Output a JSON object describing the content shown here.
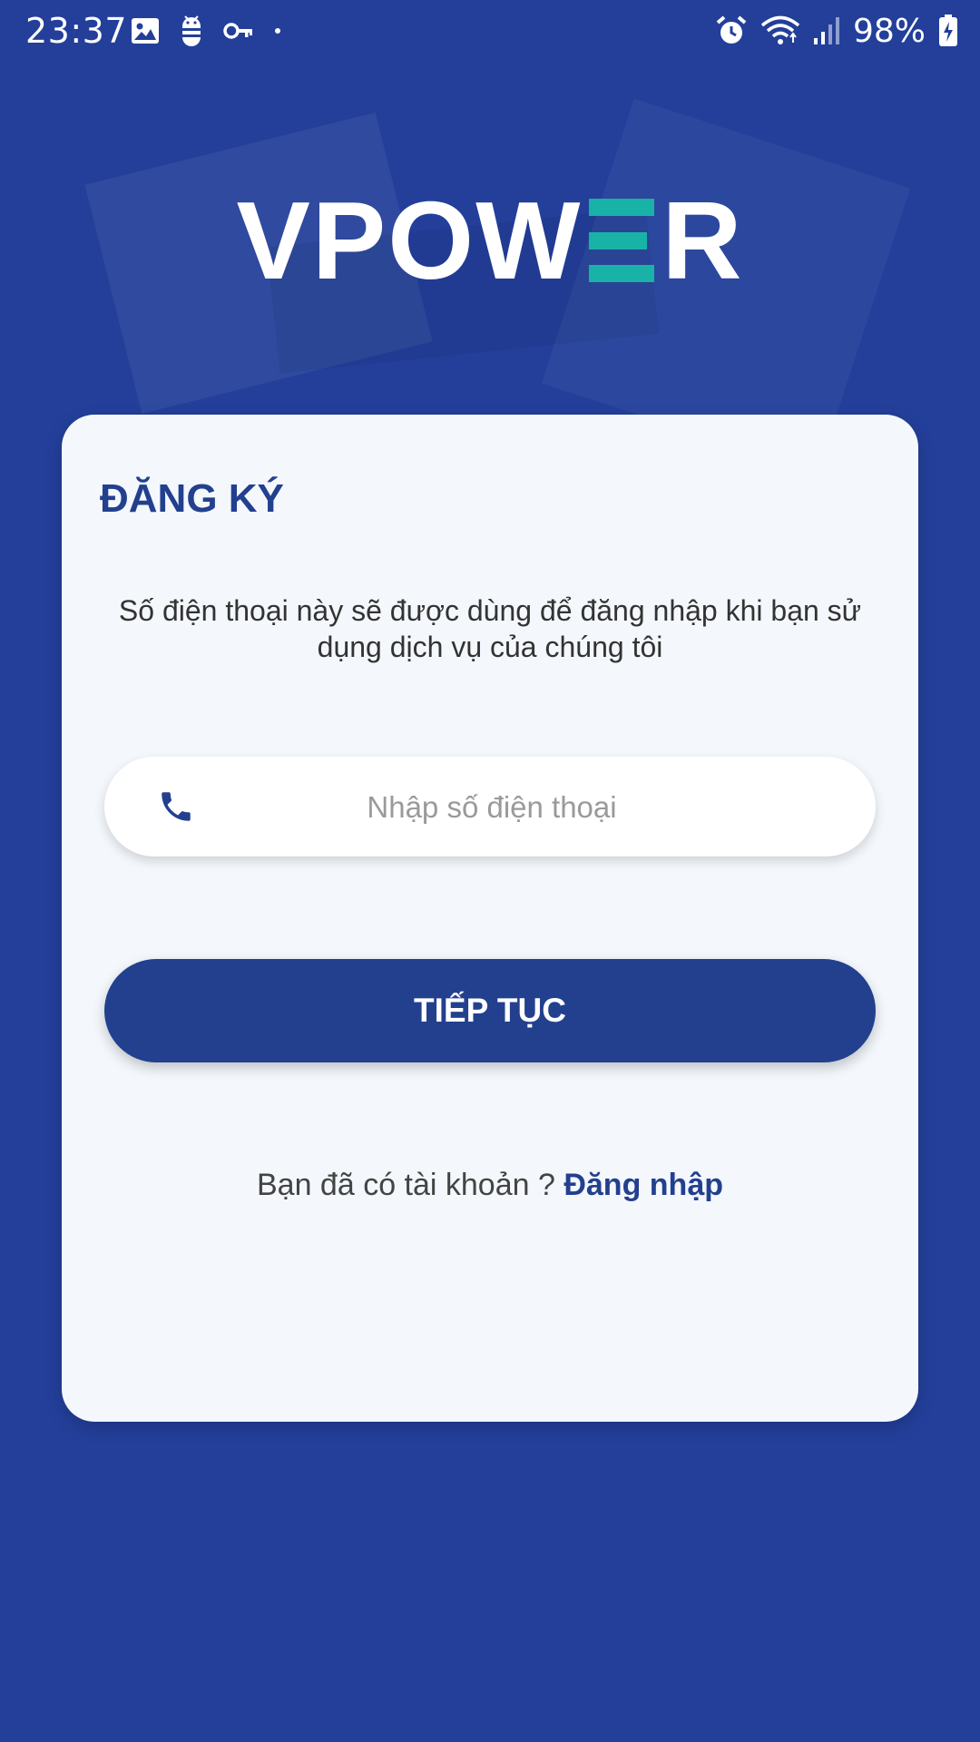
{
  "status_bar": {
    "time": "23:37",
    "battery": "98%",
    "left_icons": [
      "image-icon",
      "android-debug-icon",
      "key-icon",
      "dot-icon"
    ],
    "right_icons": [
      "alarm-icon",
      "wifi-icon",
      "signal-icon",
      "battery-charging-icon"
    ]
  },
  "logo": {
    "text_before": "VPOW",
    "text_after": "R",
    "full_text": "VPOWER",
    "accent_color": "#18b3a6"
  },
  "register": {
    "title": "ĐĂNG KÝ",
    "description": "Số điện thoại này sẽ được dùng để đăng nhập khi bạn sử dụng dịch vụ của chúng tôi",
    "phone_placeholder": "Nhập số điện thoại",
    "phone_value": "",
    "phone_icon": "phone-icon",
    "continue_label": "TIẾP TỤC",
    "have_account_text": "Bạn đã có tài khoản ? ",
    "login_link": "Đăng nhập"
  },
  "colors": {
    "background": "#233f9a",
    "card": "#f4f8fc",
    "primary": "#23408f",
    "accent": "#18b3a6"
  }
}
